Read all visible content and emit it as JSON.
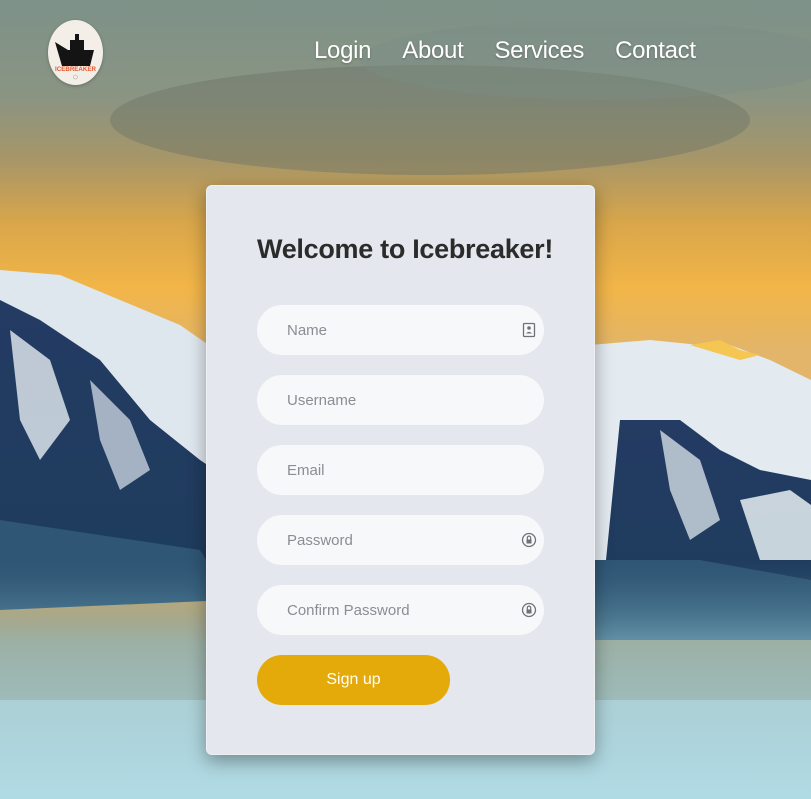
{
  "logo": {
    "text": "ICEBREAKER"
  },
  "nav": {
    "items": [
      "Login",
      "About",
      "Services",
      "Contact"
    ]
  },
  "form": {
    "title": "Welcome to Icebreaker!",
    "fields": [
      {
        "placeholder": "Name",
        "value": "",
        "icon": "contact-card-icon"
      },
      {
        "placeholder": "Username",
        "value": ""
      },
      {
        "placeholder": "Email",
        "value": ""
      },
      {
        "placeholder": "Password",
        "value": "",
        "icon": "lock-icon"
      },
      {
        "placeholder": "Confirm Password",
        "value": "",
        "icon": "lock-icon"
      }
    ],
    "submit_label": "Sign up"
  },
  "colors": {
    "accent": "#e3aa09",
    "card": "#e4e7ed",
    "field": "#f7f8fa"
  }
}
